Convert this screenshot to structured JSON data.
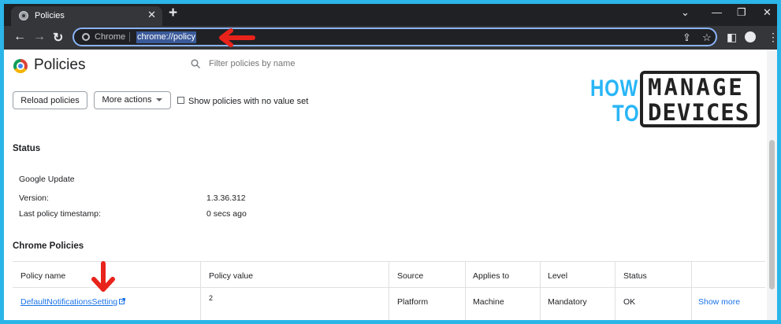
{
  "browser": {
    "tab_title": "Policies",
    "tab_close_glyph": "✕",
    "new_tab_glyph": "+",
    "window_controls": {
      "dropdown": "⌄",
      "minimize": "—",
      "restore": "❐",
      "close": "✕"
    },
    "nav": {
      "back": "←",
      "forward": "→",
      "reload": "↻"
    },
    "omnibox": {
      "scheme_label": "Chrome",
      "url": "chrome://policy"
    },
    "omnibox_icons": {
      "share": "⇪",
      "bookmark": "☆"
    },
    "toolbar_icons": {
      "sidepanel": "◧",
      "menu": "⋮"
    }
  },
  "page": {
    "title": "Policies",
    "filter_placeholder": "Filter policies by name",
    "buttons": {
      "reload": "Reload policies",
      "more_actions": "More actions"
    },
    "checkbox_label": "Show policies with no value set"
  },
  "status": {
    "heading": "Status",
    "source_title": "Google Update",
    "rows": [
      {
        "label": "Version:",
        "value": "1.3.36.312"
      },
      {
        "label": "Last policy timestamp:",
        "value": "0 secs ago"
      }
    ]
  },
  "chrome_policies": {
    "heading": "Chrome Policies",
    "columns": [
      "Policy name",
      "Policy value",
      "Source",
      "Applies to",
      "Level",
      "Status"
    ],
    "rows": [
      {
        "name": "DefaultNotificationsSetting",
        "value": "2",
        "source": "Platform",
        "applies_to": "Machine",
        "level": "Mandatory",
        "status": "OK",
        "action": "Show more"
      }
    ]
  },
  "watermark": {
    "how": "HOW",
    "to": "TO",
    "manage": "MANAGE",
    "devices": "DEVICES"
  },
  "colors": {
    "annotation_arrow": "#e8231b",
    "link": "#1a73e8",
    "border_accent": "#2bb5e8",
    "logo_blue": "#29b6f6"
  },
  "icons": [
    "chrome-logo-icon",
    "search-icon",
    "external-link-icon",
    "red-arrow-icon"
  ]
}
